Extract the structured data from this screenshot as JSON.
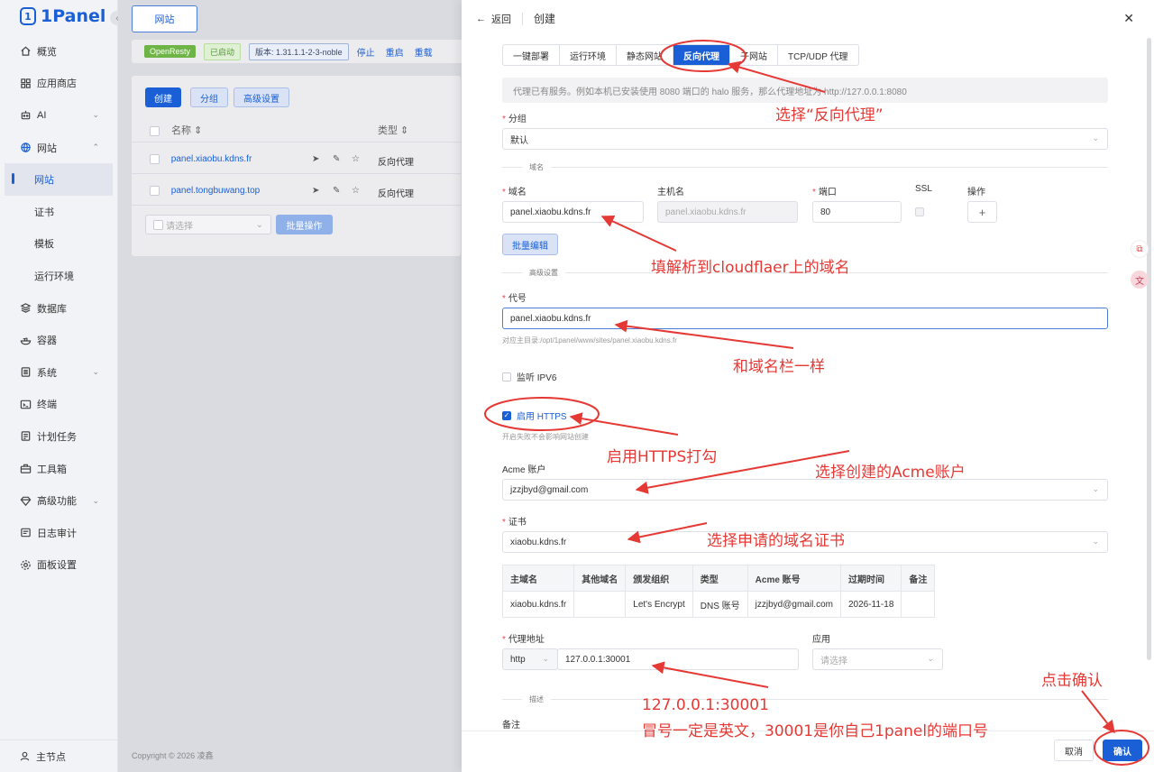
{
  "sidebar": {
    "logo": "1Panel",
    "menu": [
      {
        "label": "概览",
        "icon": "home-icon"
      },
      {
        "label": "应用商店",
        "icon": "grid-icon"
      },
      {
        "label": "AI",
        "icon": "robot-icon"
      },
      {
        "label": "网站",
        "icon": "globe-icon"
      },
      {
        "label": "网站",
        "sub": true
      },
      {
        "label": "证书",
        "sub": true
      },
      {
        "label": "模板",
        "sub": true
      },
      {
        "label": "运行环境",
        "sub": true
      },
      {
        "label": "数据库",
        "icon": "database-icon"
      },
      {
        "label": "容器",
        "icon": "container-icon"
      },
      {
        "label": "系统",
        "icon": "system-icon"
      },
      {
        "label": "终端",
        "icon": "terminal-icon"
      },
      {
        "label": "计划任务",
        "icon": "calendar-icon"
      },
      {
        "label": "工具箱",
        "icon": "toolbox-icon"
      },
      {
        "label": "高级功能",
        "icon": "diamond-icon"
      },
      {
        "label": "日志审计",
        "icon": "log-icon"
      },
      {
        "label": "面板设置",
        "icon": "settings-icon"
      }
    ],
    "footer": "主节点"
  },
  "main": {
    "top_tab": "网站",
    "toolbar": {
      "openresty": "OpenResty",
      "status": "已启动",
      "version": "版本: 1.31.1.1-2-3-noble",
      "stop": "停止",
      "restart": "重启",
      "reload": "重载"
    },
    "buttons": {
      "create": "创建",
      "group": "分组",
      "advanced": "高级设置"
    },
    "columns": {
      "name": "名称 ⇕",
      "type": "类型 ⇕"
    },
    "rows": [
      {
        "name": "panel.xiaobu.kdns.fr",
        "type": "反向代理"
      },
      {
        "name": "panel.tongbuwang.top",
        "type": "反向代理"
      }
    ],
    "select_placeholder": "请选择",
    "batch": "批量操作",
    "copyright": "Copyright © 2026 凌鑫"
  },
  "drawer": {
    "back": "返回",
    "title": "创建",
    "tabs": [
      "一键部署",
      "运行环境",
      "静态网站",
      "反向代理",
      "子网站",
      "TCP/UDP 代理"
    ],
    "alert": "代理已有服务。例如本机已安装使用 8080 端口的 halo 服务，那么代理地址为 http://127.0.0.1:8080",
    "group_label": "分组",
    "group_value": "默认",
    "section_domain": "域名",
    "domain_label": "域名",
    "host_label": "主机名",
    "port_label": "端口",
    "ssl_label": "SSL",
    "op_label": "操作",
    "domain_value": "panel.xiaobu.kdns.fr",
    "host_value": "panel.xiaobu.kdns.fr",
    "port_value": "80",
    "batch_edit": "批量编辑",
    "section_advanced": "高级设置",
    "alias_label": "代号",
    "alias_value": "panel.xiaobu.kdns.fr",
    "alias_hint": "对应主目录:/opt/1panel/www/sites/panel.xiaobu.kdns.fr",
    "ipv6": "监听 IPV6",
    "https": "启用 HTTPS",
    "https_hint": "开启失败不会影响网站创建",
    "acme_label": "Acme 账户",
    "acme_value": "jzzjbyd@gmail.com",
    "cert_label": "证书",
    "cert_value": "xiaobu.kdns.fr",
    "cert_table": {
      "headers": [
        "主域名",
        "其他域名",
        "颁发组织",
        "类型",
        "Acme 账号",
        "过期时间",
        "备注"
      ],
      "row": [
        "xiaobu.kdns.fr",
        "",
        "Let's Encrypt",
        "DNS 账号",
        "jzzjbyd@gmail.com",
        "2026-11-18",
        ""
      ]
    },
    "proxy_label": "代理地址",
    "proxy_scheme": "http",
    "proxy_value": "127.0.0.1:30001",
    "app_label": "应用",
    "app_placeholder": "请选择",
    "section_desc": "描述",
    "remark_label": "备注",
    "cancel": "取消",
    "confirm": "确认"
  },
  "annotations": {
    "a1": "选择“反向代理”",
    "a2": "填解析到cloudflaer上的域名",
    "a3": "和域名栏一样",
    "a4": "启用HTTPS打勾",
    "a5": "选择创建的Acme账户",
    "a6": "选择申请的域名证书",
    "a7": "点击确认",
    "a8_line1": "127.0.0.1:30001",
    "a8_line2": "冒号一定是英文，30001是你自己1panel的端口号"
  },
  "colors": {
    "accent": "#1a5fd6",
    "annotation": "#e53935"
  }
}
